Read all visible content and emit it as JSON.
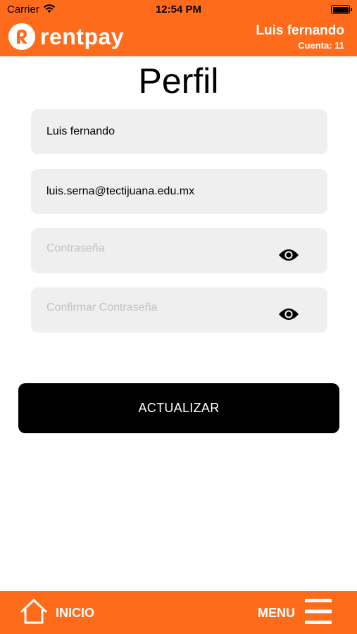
{
  "status_bar": {
    "carrier": "Carrier",
    "time": "12:54 PM",
    "icons": [
      "wifi-icon",
      "battery-icon"
    ]
  },
  "app_bar": {
    "brand": "rentpay",
    "user_name": "Luis fernando",
    "account": "Cuenta: 11"
  },
  "page": {
    "title": "Perfil"
  },
  "form": {
    "name_value": "Luis fernando",
    "email_value": "luis.serna@tectijuana.edu.mx",
    "password_placeholder": "Contraseña",
    "confirm_placeholder": "Confirmar Contraseña",
    "submit_label": "ACTUALIZAR"
  },
  "bottom_nav": {
    "home_label": "INICIO",
    "menu_label": "MENU"
  },
  "colors": {
    "brand_orange": "#fe6b1a",
    "field_bg": "#efefef",
    "button_bg": "#000000"
  }
}
